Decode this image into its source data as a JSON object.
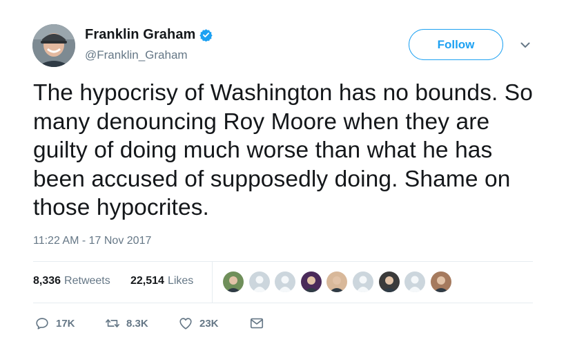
{
  "user": {
    "display_name": "Franklin Graham",
    "handle": "@Franklin_Graham",
    "verified": true
  },
  "follow_button": {
    "label": "Follow"
  },
  "tweet": {
    "text": "The hypocrisy of Washington has no bounds. So many denouncing Roy Moore when they are guilty of doing much worse than what he has been accused of supposedly doing. Shame on those hypocrites.",
    "timestamp": "11:22 AM - 17 Nov 2017"
  },
  "stats": {
    "retweets_count": "8,336",
    "retweets_label": "Retweets",
    "likes_count": "22,514",
    "likes_label": "Likes"
  },
  "likers": [
    {
      "kind": "photo",
      "color": "#6f8f5a"
    },
    {
      "kind": "default",
      "color": "#aab8c2"
    },
    {
      "kind": "default",
      "color": "#aab8c2"
    },
    {
      "kind": "photo",
      "color": "#4a2a5a"
    },
    {
      "kind": "photo",
      "color": "#d8b89a"
    },
    {
      "kind": "default",
      "color": "#aab8c2"
    },
    {
      "kind": "photo",
      "color": "#3b3b3b"
    },
    {
      "kind": "default",
      "color": "#aab8c2"
    },
    {
      "kind": "photo",
      "color": "#a57a5e"
    }
  ],
  "actions": {
    "reply_count": "17K",
    "retweet_count": "8.3K",
    "like_count": "23K"
  },
  "colors": {
    "accent": "#1da1f2",
    "text": "#14171a",
    "secondary": "#657786",
    "divider": "#e6ecf0"
  },
  "icons": {
    "verified": "verified-badge-icon",
    "caret": "chevron-down-icon",
    "reply": "reply-icon",
    "retweet": "retweet-icon",
    "like": "heart-icon",
    "dm": "envelope-icon"
  }
}
